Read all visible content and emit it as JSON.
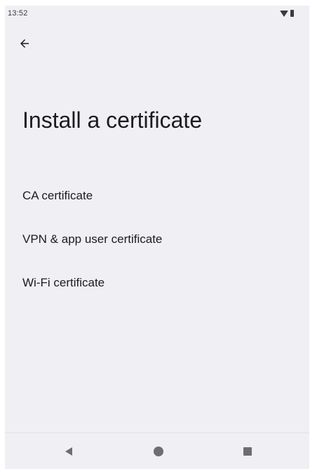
{
  "status_bar": {
    "time": "13:52",
    "icons": [
      "wifi-icon",
      "battery-icon"
    ]
  },
  "toolbar": {
    "back_icon": "arrow-left-icon"
  },
  "page": {
    "title": "Install a certificate"
  },
  "list": {
    "items": [
      {
        "label": "CA certificate"
      },
      {
        "label": "VPN & app user certificate"
      },
      {
        "label": "Wi-Fi certificate"
      }
    ]
  },
  "nav_bar": {
    "icons": [
      "nav-back-icon",
      "nav-home-icon",
      "nav-recents-icon"
    ]
  },
  "colors": {
    "background": "#f0eff4",
    "text_primary": "#1c1b1f",
    "nav_icon": "#6e6e72"
  }
}
